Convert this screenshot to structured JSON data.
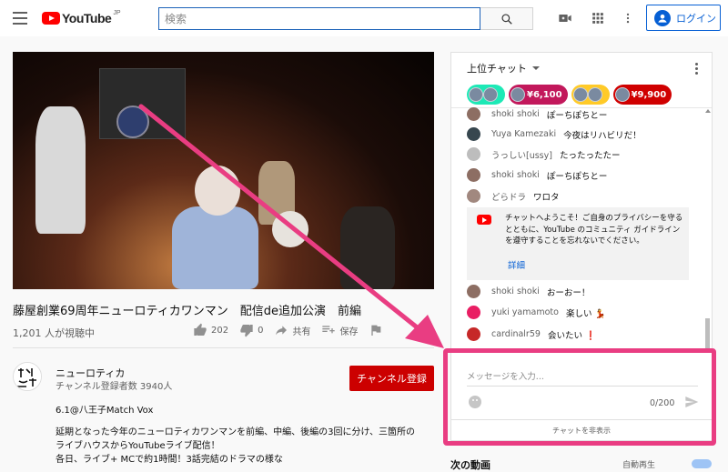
{
  "masthead": {
    "logo_text": "YouTube",
    "logo_region": "JP",
    "search_placeholder": "検索",
    "login_label": "ログイン",
    "icons": [
      "menu-icon",
      "search-icon",
      "create-video-icon",
      "apps-icon",
      "more-vertical-icon",
      "account-icon"
    ]
  },
  "video": {
    "title": "藤屋創業69周年ニューロティカワンマン　配信de追加公演　前編",
    "views": "1,201 人が視聴中",
    "likes": "202",
    "dislikes": "0",
    "share_label": "共有",
    "save_label": "保存"
  },
  "owner": {
    "name": "ニューロティカ",
    "subscribers": "チャンネル登録者数 3940人",
    "subscribe_label": "チャンネル登録"
  },
  "description": {
    "line1": "6.1@八王子Match Vox",
    "line2": "延期となった今年のニューロティカワンマンを前編、中編、後編の3回に分け、三箇所の",
    "line3": "ライブハウスからYouTubeライブ配信！",
    "line4": "各日、ライブ+ MCで約1時間！3話完結のドラマの様な"
  },
  "chat": {
    "header": "上位チャット",
    "tickers": [
      {
        "amount": "",
        "color": "#1de9b6"
      },
      {
        "amount": "¥6,100",
        "color": "#c2185b"
      },
      {
        "amount": "",
        "color": "#ffca28"
      },
      {
        "amount": "¥9,900",
        "color": "#d00000"
      }
    ],
    "messages_top": [
      {
        "author": "shoki shoki",
        "text": "ぽーちぽちとー",
        "avatar": "#8d6e63"
      },
      {
        "author": "Yuya Kamezaki",
        "text": "今夜はリハビリだ！",
        "avatar": "#37474f"
      },
      {
        "author": "うっしい[ussy]",
        "text": "たったったたー",
        "avatar": "#bdbdbd"
      },
      {
        "author": "shoki shoki",
        "text": "ぽーちぽちとー",
        "avatar": "#8d6e63"
      },
      {
        "author": "どらドラ",
        "text": "ワロタ",
        "avatar": "#a1887f"
      }
    ],
    "notice_text": "チャットへようこそ！ご自身のプライバシーを守るとともに、YouTube のコミュニティ ガイドラインを遵守することを忘れないでください。",
    "notice_link": "詳細",
    "messages_bottom": [
      {
        "author": "shoki shoki",
        "text": "おーおー！",
        "avatar": "#8d6e63"
      },
      {
        "author": "yuki yamamoto",
        "text": "楽しい 💃",
        "avatar": "#e91e63"
      },
      {
        "author": "cardinalr59",
        "text": "会いたい ❗",
        "avatar": "#c62828"
      }
    ],
    "input_placeholder": "メッセージを入力...",
    "counter": "0/200",
    "hide_label": "チャットを非表示"
  },
  "sidebar": {
    "next_label": "次の動画",
    "autoplay_label": "自動再生"
  },
  "colors": {
    "highlight": "#e93d82",
    "subscribe": "#cc0000",
    "link": "#065fd4"
  }
}
